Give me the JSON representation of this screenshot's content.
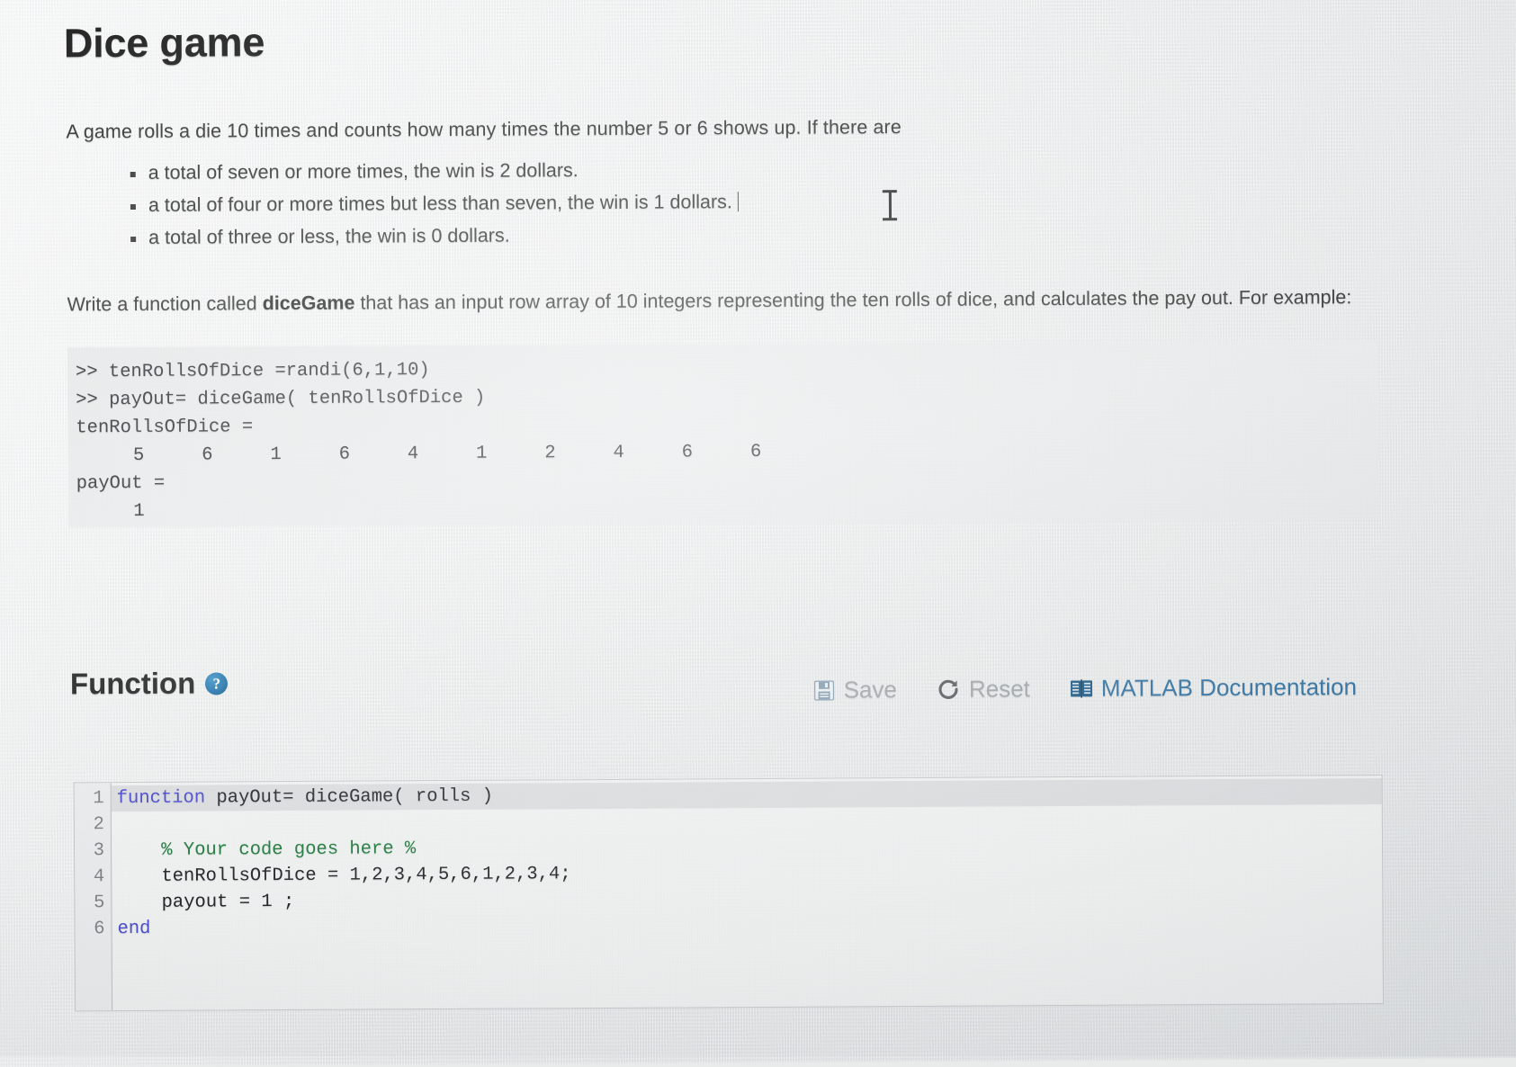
{
  "page_title": "Dice game",
  "intro": "A game rolls a die 10 times and counts how many times the number 5 or 6 shows up. If there are",
  "bullets": [
    "a total of seven or more times, the win is 2 dollars.",
    "a total of four or more times but less than seven, the win is 1 dollars.",
    "a total of three or less, the win is 0 dollars."
  ],
  "write_instruction": {
    "before": "Write a function called ",
    "function_name": "diceGame",
    "after": " that has an input row array of 10 integers representing the ten rolls of dice, and calculates the pay out. For example:"
  },
  "console_example": {
    "lines": [
      ">> tenRollsOfDice =randi(6,1,10)",
      ">> payOut= diceGame( tenRollsOfDice )",
      "tenRollsOfDice ="
    ],
    "dice_values": "     5     6     1     6     4     1     2     4     6     6",
    "payout_label": "payOut =",
    "payout_value": "     1"
  },
  "function_section": {
    "heading": "Function",
    "help_icon_label": "?",
    "toolbar": {
      "save_label": "Save",
      "save_icon": "floppy-disk-icon",
      "reset_label": "Reset",
      "reset_icon": "refresh-icon",
      "doc_label": "MATLAB Documentation",
      "doc_icon": "book-icon"
    }
  },
  "editor": {
    "line_numbers": [
      "1",
      "2",
      "3",
      "4",
      "5",
      "6"
    ],
    "lines": [
      {
        "keyword": "function",
        "rest": " payOut= diceGame( rolls )"
      },
      {
        "keyword": "",
        "rest": ""
      },
      {
        "comment": "    % Your code goes here %"
      },
      {
        "keyword": "",
        "rest": "    tenRollsOfDice = 1,2,3,4,5,6,1,2,3,4;"
      },
      {
        "keyword": "",
        "rest": "    payout = 1 ;"
      },
      {
        "keyword": "end",
        "rest": ""
      }
    ],
    "line1_keyword": "function",
    "line1_rest": " payOut= diceGame( rolls )",
    "line2_text": "",
    "line3_comment": "    % Your code goes here %",
    "line4_text": "    tenRollsOfDice = 1,2,3,4,5,6,1,2,3,4;",
    "line5_text": "    payout = 1 ;",
    "line6_keyword": "end"
  },
  "colors": {
    "keyword_blue": "#4a4ad2",
    "comment_green": "#1f7a3d",
    "doc_link_blue": "#2d6e9e",
    "help_badge_blue": "#1a6ea5",
    "toolbar_gray": "#9aa0a4"
  }
}
